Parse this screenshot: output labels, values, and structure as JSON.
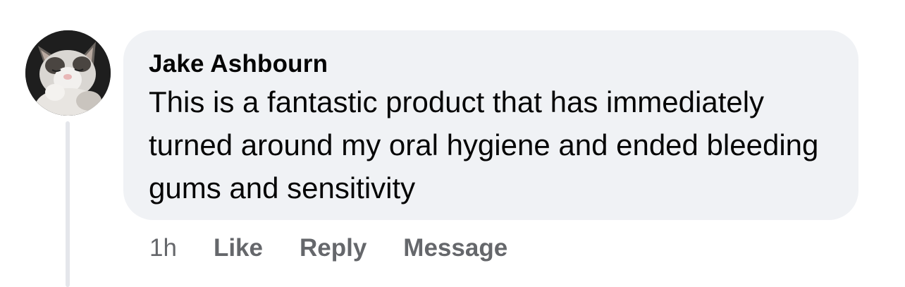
{
  "comment": {
    "author": "Jake Ashbourn",
    "text": "This is a fantastic product that has immediately turned around my oral hygiene and ended bleeding gums and sensitivity",
    "avatar_icon": "cat-photo-avatar"
  },
  "actions": {
    "timestamp": "1h",
    "like_label": "Like",
    "reply_label": "Reply",
    "message_label": "Message"
  },
  "colors": {
    "bubble_bg": "#f0f2f5",
    "text": "#050505",
    "secondary_text": "#65676b",
    "thread_line": "#e4e6eb"
  }
}
